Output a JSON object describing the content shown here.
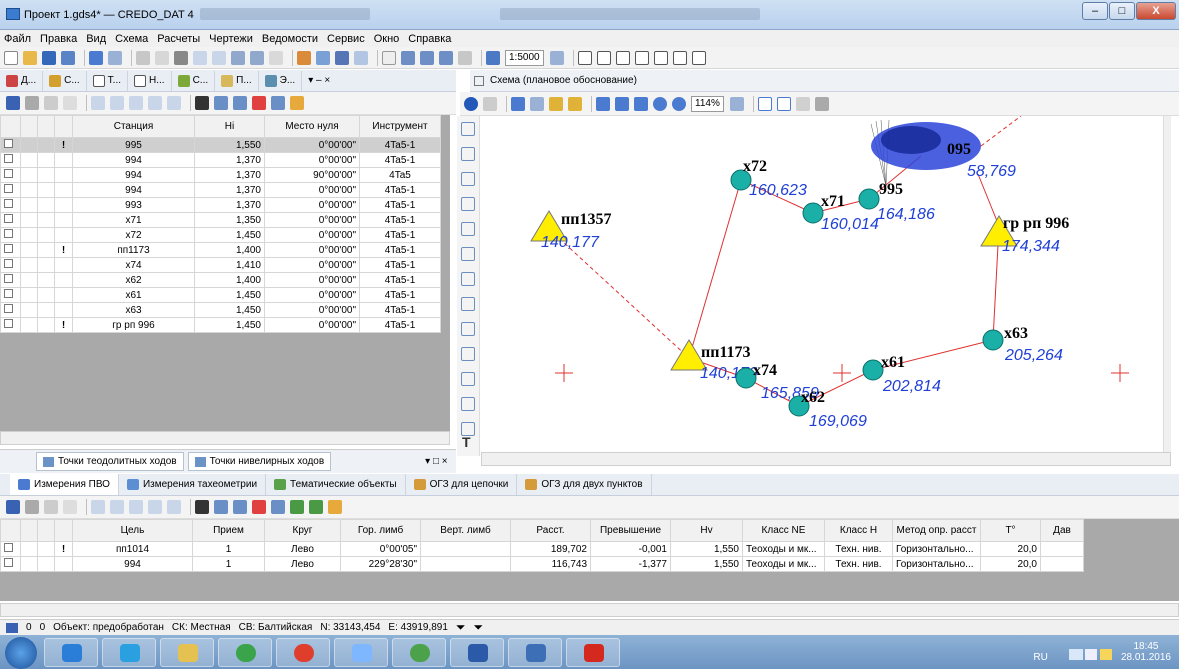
{
  "window": {
    "title": "Проект 1.gds4* — CREDO_DAT 4",
    "minimize": "–",
    "maximize": "□",
    "close": "X"
  },
  "menu": [
    "Файл",
    "Правка",
    "Вид",
    "Схема",
    "Расчеты",
    "Чертежи",
    "Ведомости",
    "Сервис",
    "Окно",
    "Справка"
  ],
  "toolbar": {
    "scale": "1:5000"
  },
  "left_tabs": [
    "Д...",
    "С...",
    "Т...",
    "Н...",
    "С...",
    "П...",
    "Э..."
  ],
  "station_table": {
    "headers": [
      "Станция",
      "Hi",
      "Место нуля",
      "Инструмент"
    ],
    "rows": [
      {
        "flag": "!",
        "station": "995",
        "hi": "1,550",
        "zero": "0°00'00\"",
        "instr": "4Ta5-1"
      },
      {
        "flag": "",
        "station": "994",
        "hi": "1,370",
        "zero": "0°00'00\"",
        "instr": "4Ta5-1"
      },
      {
        "flag": "",
        "station": "994",
        "hi": "1,370",
        "zero": "90°00'00\"",
        "instr": "4Ta5"
      },
      {
        "flag": "",
        "station": "994",
        "hi": "1,370",
        "zero": "0°00'00\"",
        "instr": "4Ta5-1"
      },
      {
        "flag": "",
        "station": "993",
        "hi": "1,370",
        "zero": "0°00'00\"",
        "instr": "4Ta5-1"
      },
      {
        "flag": "",
        "station": "х71",
        "hi": "1,350",
        "zero": "0°00'00\"",
        "instr": "4Ta5-1"
      },
      {
        "flag": "",
        "station": "х72",
        "hi": "1,450",
        "zero": "0°00'00\"",
        "instr": "4Ta5-1"
      },
      {
        "flag": "!",
        "station": "пп1173",
        "hi": "1,400",
        "zero": "0°00'00\"",
        "instr": "4Ta5-1"
      },
      {
        "flag": "",
        "station": "х74",
        "hi": "1,410",
        "zero": "0°00'00\"",
        "instr": "4Ta5-1"
      },
      {
        "flag": "",
        "station": "х62",
        "hi": "1,400",
        "zero": "0°00'00\"",
        "instr": "4Ta5-1"
      },
      {
        "flag": "",
        "station": "х61",
        "hi": "1,450",
        "zero": "0°00'00\"",
        "instr": "4Ta5-1"
      },
      {
        "flag": "",
        "station": "х63",
        "hi": "1,450",
        "zero": "0°00'00\"",
        "instr": "4Ta5-1"
      },
      {
        "flag": "!",
        "station": "гр рп 996",
        "hi": "1,450",
        "zero": "0°00'00\"",
        "instr": "4Ta5-1"
      }
    ]
  },
  "bottom_tabs": [
    "Точки теодолитных ходов",
    "Точки нивелирных ходов"
  ],
  "panel_ctrl": "▾ □ ×",
  "scheme": {
    "title": "Схема (плановое обоснование)",
    "zoom": "114%",
    "points": [
      {
        "name": "пп1357",
        "value": "140,177",
        "kind": "tri"
      },
      {
        "name": "х72",
        "value": "160,623",
        "kind": "circ"
      },
      {
        "name": "х71",
        "value": "160,014",
        "kind": "circ"
      },
      {
        "name": "995",
        "value": "164,186",
        "kind": "circ"
      },
      {
        "name": "095",
        "value": "58,769",
        "kind": "none"
      },
      {
        "name": "гр рп 996",
        "value": "174,344",
        "kind": "tri"
      },
      {
        "name": "х63",
        "value": "205,264",
        "kind": "circ"
      },
      {
        "name": "х61",
        "value": "202,814",
        "kind": "circ"
      },
      {
        "name": "пп1173",
        "value": "140,179",
        "kind": "tri"
      },
      {
        "name": "х74",
        "value": "165,859",
        "kind": "circ"
      },
      {
        "name": "х62",
        "value": "169,069",
        "kind": "circ"
      }
    ]
  },
  "main_tabs": [
    "Измерения ПВО",
    "Измерения тахеометрии",
    "Тематические объекты",
    "ОГЗ для цепочки",
    "ОГЗ для двух пунктов"
  ],
  "meas_table": {
    "headers": [
      "Цель",
      "Прием",
      "Круг",
      "Гор. лимб",
      "Верт. лимб",
      "Расст.",
      "Превышение",
      "Hv",
      "Класс NE",
      "Класс H",
      "Метод опр. расст",
      "T°",
      "Дав"
    ],
    "rows": [
      {
        "flag": "!",
        "target": "пп1014",
        "recv": "1",
        "circle": "Лево",
        "hor": "0°00'05\"",
        "vert": "",
        "dist": "189,702",
        "elev": "-0,001",
        "hv": "1,550",
        "classne": "Теоходы и мк...",
        "classh": "Техн. нив.",
        "method": "Горизонтально...",
        "t": "20,0",
        "p": ""
      },
      {
        "flag": "",
        "target": "994",
        "recv": "1",
        "circle": "Лево",
        "hor": "229°28'30\"",
        "vert": "",
        "dist": "116,743",
        "elev": "-1,377",
        "hv": "1,550",
        "classne": "Теоходы и мк...",
        "classh": "Техн. нив.",
        "method": "Горизонтально...",
        "t": "20,0",
        "p": ""
      }
    ]
  },
  "status": {
    "a": "0",
    "b": "0",
    "object": "Объект: предобработан",
    "sk": "СК: Местная",
    "sv": "СВ: Балтийская",
    "n": "N: 33143,454",
    "e": "E: 43919,891"
  },
  "tray": {
    "lang": "RU",
    "time": "18:45",
    "date": "28.01.2016"
  },
  "colors": {
    "accent": "#1f3fd6",
    "route": "#e03030",
    "point": "#1ab0a8",
    "triangle": "#ffee00"
  }
}
